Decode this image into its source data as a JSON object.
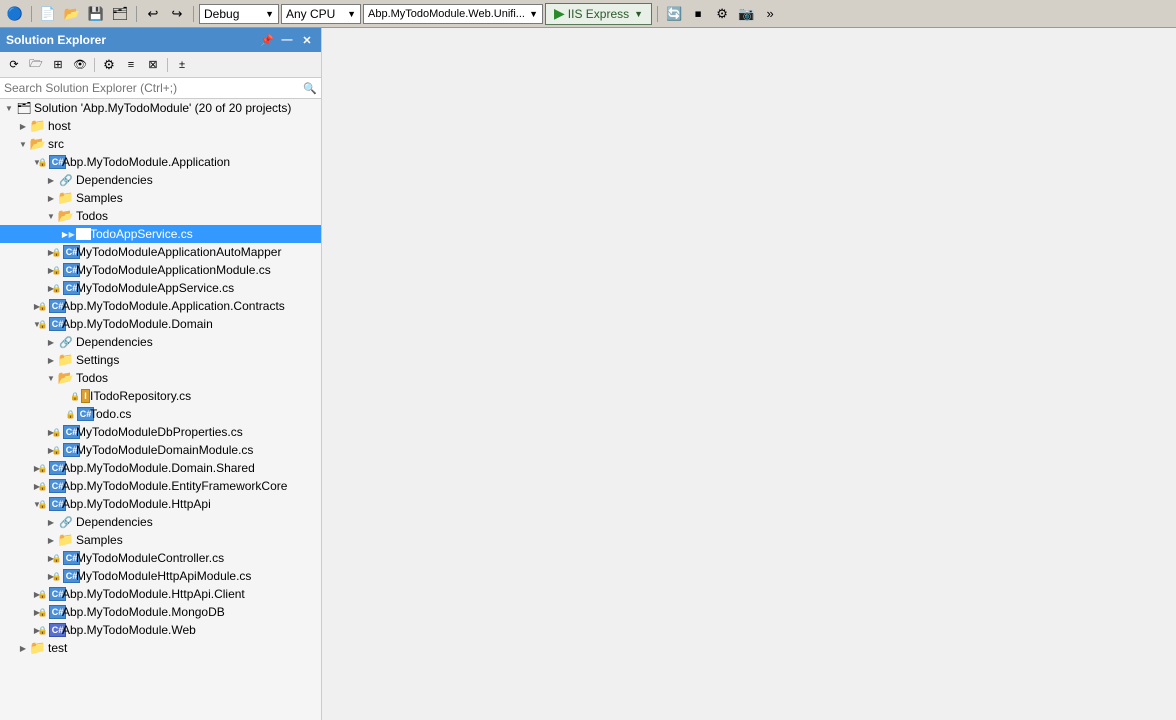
{
  "toolbar": {
    "debug_label": "Debug",
    "cpu_label": "Any CPU",
    "project_label": "Abp.MyTodoModule.Web.Unifi...",
    "run_label": "IIS Express",
    "save_label": "Save",
    "undo_label": "Undo",
    "redo_label": "Redo"
  },
  "panel": {
    "title": "Solution Explorer",
    "search_placeholder": "Search Solution Explorer (Ctrl+;)"
  },
  "tree": {
    "root": "Solution 'Abp.MyTodoModule' (20 of 20 projects)",
    "items": [
      {
        "id": "solution",
        "label": "Solution 'Abp.MyTodoModule' (20 of 20 projects)",
        "indent": 0,
        "icon": "solution",
        "expanded": true,
        "selected": false
      },
      {
        "id": "host",
        "label": "host",
        "indent": 1,
        "icon": "folder",
        "expanded": false,
        "selected": false
      },
      {
        "id": "src",
        "label": "src",
        "indent": 1,
        "icon": "folder",
        "expanded": true,
        "selected": false
      },
      {
        "id": "app-application",
        "label": "Abp.MyTodoModule.Application",
        "indent": 2,
        "icon": "proj-cs",
        "expanded": true,
        "selected": false
      },
      {
        "id": "app-dep",
        "label": "Dependencies",
        "indent": 3,
        "icon": "dep",
        "expanded": false,
        "selected": false
      },
      {
        "id": "app-samples",
        "label": "Samples",
        "indent": 3,
        "icon": "folder",
        "expanded": false,
        "selected": false
      },
      {
        "id": "app-todos",
        "label": "Todos",
        "indent": 3,
        "icon": "folder",
        "expanded": true,
        "selected": false
      },
      {
        "id": "app-todoappservice",
        "label": "TodoAppService.cs",
        "indent": 4,
        "icon": "cs",
        "expanded": false,
        "selected": true
      },
      {
        "id": "app-automapper",
        "label": "MyTodoModuleApplicationAutoMapper",
        "indent": 3,
        "icon": "cs-lock",
        "expanded": false,
        "selected": false
      },
      {
        "id": "app-module",
        "label": "MyTodoModuleApplicationModule.cs",
        "indent": 3,
        "icon": "cs-lock",
        "expanded": false,
        "selected": false
      },
      {
        "id": "app-appservice",
        "label": "MyTodoModuleAppService.cs",
        "indent": 3,
        "icon": "cs-lock",
        "expanded": false,
        "selected": false
      },
      {
        "id": "app-contracts",
        "label": "Abp.MyTodoModule.Application.Contracts",
        "indent": 2,
        "icon": "proj-cs",
        "expanded": false,
        "selected": false
      },
      {
        "id": "domain",
        "label": "Abp.MyTodoModule.Domain",
        "indent": 2,
        "icon": "proj-cs",
        "expanded": true,
        "selected": false
      },
      {
        "id": "domain-dep",
        "label": "Dependencies",
        "indent": 3,
        "icon": "dep",
        "expanded": false,
        "selected": false
      },
      {
        "id": "domain-settings",
        "label": "Settings",
        "indent": 3,
        "icon": "folder",
        "expanded": false,
        "selected": false
      },
      {
        "id": "domain-todos",
        "label": "Todos",
        "indent": 3,
        "icon": "folder",
        "expanded": true,
        "selected": false
      },
      {
        "id": "domain-itodorepo",
        "label": "ITodoRepository.cs",
        "indent": 4,
        "icon": "interface-lock",
        "expanded": false,
        "selected": false
      },
      {
        "id": "domain-todo",
        "label": "Todo.cs",
        "indent": 4,
        "icon": "cs-lock",
        "expanded": false,
        "selected": false
      },
      {
        "id": "domain-dbprops",
        "label": "MyTodoModuleDbProperties.cs",
        "indent": 3,
        "icon": "cs-lock",
        "expanded": false,
        "selected": false
      },
      {
        "id": "domain-module",
        "label": "MyTodoModuleDomainModule.cs",
        "indent": 3,
        "icon": "cs-lock",
        "expanded": false,
        "selected": false
      },
      {
        "id": "domain-shared",
        "label": "Abp.MyTodoModule.Domain.Shared",
        "indent": 2,
        "icon": "proj-cs",
        "expanded": false,
        "selected": false
      },
      {
        "id": "ef-core",
        "label": "Abp.MyTodoModule.EntityFrameworkCore",
        "indent": 2,
        "icon": "proj-cs",
        "expanded": false,
        "selected": false
      },
      {
        "id": "httpapi",
        "label": "Abp.MyTodoModule.HttpApi",
        "indent": 2,
        "icon": "proj-cs",
        "expanded": true,
        "selected": false
      },
      {
        "id": "httpapi-dep",
        "label": "Dependencies",
        "indent": 3,
        "icon": "dep",
        "expanded": false,
        "selected": false
      },
      {
        "id": "httpapi-samples",
        "label": "Samples",
        "indent": 3,
        "icon": "folder",
        "expanded": false,
        "selected": false
      },
      {
        "id": "httpapi-controller",
        "label": "MyTodoModuleController.cs",
        "indent": 3,
        "icon": "cs-lock",
        "expanded": false,
        "selected": false
      },
      {
        "id": "httpapi-module",
        "label": "MyTodoModuleHttpApiModule.cs",
        "indent": 3,
        "icon": "cs-lock",
        "expanded": false,
        "selected": false
      },
      {
        "id": "httpapi-client",
        "label": "Abp.MyTodoModule.HttpApi.Client",
        "indent": 2,
        "icon": "proj-cs",
        "expanded": false,
        "selected": false
      },
      {
        "id": "mongodb",
        "label": "Abp.MyTodoModule.MongoDB",
        "indent": 2,
        "icon": "proj-cs",
        "expanded": false,
        "selected": false
      },
      {
        "id": "web",
        "label": "Abp.MyTodoModule.Web",
        "indent": 2,
        "icon": "proj-cs-bold",
        "expanded": false,
        "selected": false
      },
      {
        "id": "test",
        "label": "test",
        "indent": 1,
        "icon": "folder",
        "expanded": false,
        "selected": false
      }
    ]
  }
}
